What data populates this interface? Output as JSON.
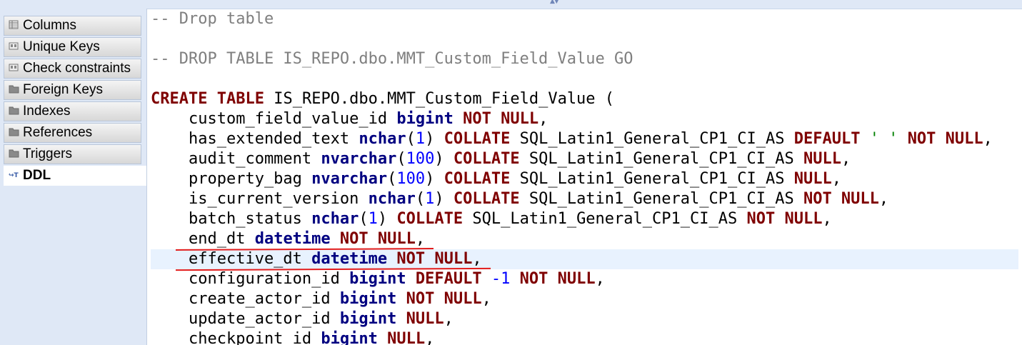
{
  "tabs": [
    {
      "label": "Columns",
      "icon": "columns-icon",
      "active": false
    },
    {
      "label": "Unique Keys",
      "icon": "key-icon",
      "active": false
    },
    {
      "label": "Check constraints",
      "icon": "check-constraint-icon",
      "active": false
    },
    {
      "label": "Foreign Keys",
      "icon": "folder-icon",
      "active": false
    },
    {
      "label": "Indexes",
      "icon": "folder-icon",
      "active": false
    },
    {
      "label": "References",
      "icon": "folder-icon",
      "active": false
    },
    {
      "label": "Triggers",
      "icon": "folder-icon",
      "active": false
    },
    {
      "label": "DDL",
      "icon": "ddl-icon",
      "active": true
    }
  ],
  "colors": {
    "comment": "#7f7f7f",
    "keyword": "#7f0000",
    "type": "#000080",
    "number": "#0000ff",
    "string": "#008000",
    "annotation": "#e21c1c",
    "current_line": "#e8f2fe",
    "panel_bg": "#dfe8f6"
  },
  "code": [
    [
      [
        "comment",
        "-- Drop table"
      ]
    ],
    [],
    [
      [
        "comment",
        "-- DROP TABLE IS_REPO.dbo.MMT_Custom_Field_Value GO"
      ]
    ],
    [],
    [
      [
        "keyword",
        "CREATE"
      ],
      [
        "ident",
        " "
      ],
      [
        "keyword",
        "TABLE"
      ],
      [
        "ident",
        " IS_REPO.dbo.MMT_Custom_Field_Value ("
      ]
    ],
    [
      [
        "ident",
        "    custom_field_value_id "
      ],
      [
        "type",
        "bigint"
      ],
      [
        "ident",
        " "
      ],
      [
        "keyword",
        "NOT NULL"
      ],
      [
        "ident",
        ","
      ]
    ],
    [
      [
        "ident",
        "    has_extended_text "
      ],
      [
        "type",
        "nchar"
      ],
      [
        "ident",
        "("
      ],
      [
        "number",
        "1"
      ],
      [
        "ident",
        ") "
      ],
      [
        "keyword",
        "COLLATE"
      ],
      [
        "ident",
        " SQL_Latin1_General_CP1_CI_AS "
      ],
      [
        "keyword",
        "DEFAULT"
      ],
      [
        "ident",
        " "
      ],
      [
        "string",
        "' '"
      ],
      [
        "ident",
        " "
      ],
      [
        "keyword",
        "NOT NULL"
      ],
      [
        "ident",
        ","
      ]
    ],
    [
      [
        "ident",
        "    audit_comment "
      ],
      [
        "type",
        "nvarchar"
      ],
      [
        "ident",
        "("
      ],
      [
        "number",
        "100"
      ],
      [
        "ident",
        ") "
      ],
      [
        "keyword",
        "COLLATE"
      ],
      [
        "ident",
        " SQL_Latin1_General_CP1_CI_AS "
      ],
      [
        "keyword",
        "NULL"
      ],
      [
        "ident",
        ","
      ]
    ],
    [
      [
        "ident",
        "    property_bag "
      ],
      [
        "type",
        "nvarchar"
      ],
      [
        "ident",
        "("
      ],
      [
        "number",
        "100"
      ],
      [
        "ident",
        ") "
      ],
      [
        "keyword",
        "COLLATE"
      ],
      [
        "ident",
        " SQL_Latin1_General_CP1_CI_AS "
      ],
      [
        "keyword",
        "NULL"
      ],
      [
        "ident",
        ","
      ]
    ],
    [
      [
        "ident",
        "    is_current_version "
      ],
      [
        "type",
        "nchar"
      ],
      [
        "ident",
        "("
      ],
      [
        "number",
        "1"
      ],
      [
        "ident",
        ") "
      ],
      [
        "keyword",
        "COLLATE"
      ],
      [
        "ident",
        " SQL_Latin1_General_CP1_CI_AS "
      ],
      [
        "keyword",
        "NOT NULL"
      ],
      [
        "ident",
        ","
      ]
    ],
    [
      [
        "ident",
        "    batch_status "
      ],
      [
        "type",
        "nchar"
      ],
      [
        "ident",
        "("
      ],
      [
        "number",
        "1"
      ],
      [
        "ident",
        ") "
      ],
      [
        "keyword",
        "COLLATE"
      ],
      [
        "ident",
        " SQL_Latin1_General_CP1_CI_AS "
      ],
      [
        "keyword",
        "NOT NULL"
      ],
      [
        "ident",
        ","
      ]
    ],
    [
      [
        "ident",
        "    end_dt "
      ],
      [
        "type",
        "datetime"
      ],
      [
        "ident",
        " "
      ],
      [
        "keyword",
        "NOT NULL"
      ],
      [
        "ident",
        ","
      ]
    ],
    [
      [
        "ident",
        "    effective_dt "
      ],
      [
        "type",
        "datetime"
      ],
      [
        "ident",
        " "
      ],
      [
        "keyword",
        "NOT NULL"
      ],
      [
        "ident",
        ","
      ]
    ],
    [
      [
        "ident",
        "    configuration_id "
      ],
      [
        "type",
        "bigint"
      ],
      [
        "ident",
        " "
      ],
      [
        "keyword",
        "DEFAULT"
      ],
      [
        "ident",
        " "
      ],
      [
        "number",
        "-1"
      ],
      [
        "ident",
        " "
      ],
      [
        "keyword",
        "NOT NULL"
      ],
      [
        "ident",
        ","
      ]
    ],
    [
      [
        "ident",
        "    create_actor_id "
      ],
      [
        "type",
        "bigint"
      ],
      [
        "ident",
        " "
      ],
      [
        "keyword",
        "NOT NULL"
      ],
      [
        "ident",
        ","
      ]
    ],
    [
      [
        "ident",
        "    update_actor_id "
      ],
      [
        "type",
        "bigint"
      ],
      [
        "ident",
        " "
      ],
      [
        "keyword",
        "NULL"
      ],
      [
        "ident",
        ","
      ]
    ],
    [
      [
        "ident",
        "    checkpoint_id "
      ],
      [
        "type",
        "bigint"
      ],
      [
        "ident",
        " "
      ],
      [
        "keyword",
        "NULL"
      ],
      [
        "ident",
        ","
      ]
    ]
  ],
  "current_line_index": 12,
  "underlined_line_indexes": [
    11,
    12
  ]
}
